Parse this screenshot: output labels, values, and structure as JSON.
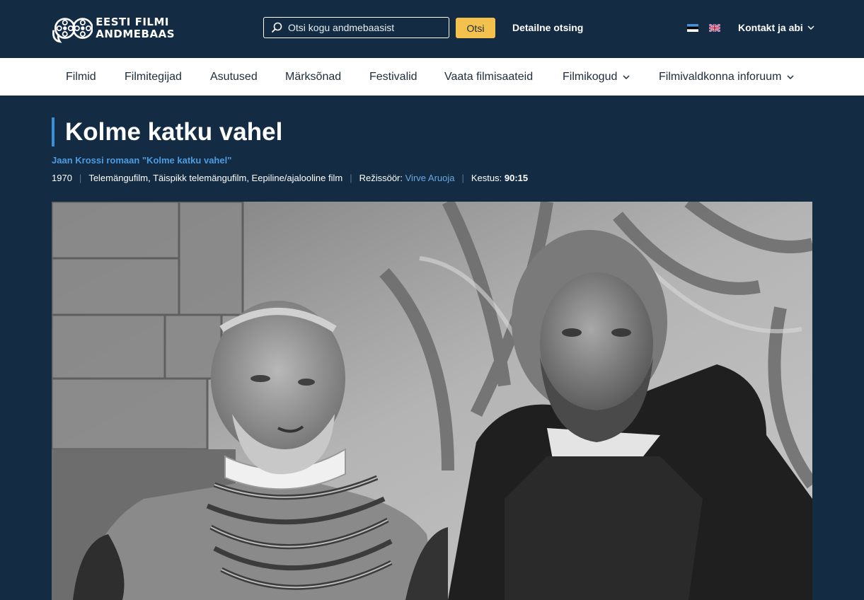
{
  "header": {
    "logo_line1": "EESTI FILMI",
    "logo_line2": "ANDMEBAAS",
    "search_placeholder": "Otsi kogu andmebaasist",
    "search_button": "Otsi",
    "advanced_search": "Detailne otsing",
    "contact": "Kontakt ja abi",
    "languages": [
      "estonian-flag-icon",
      "uk-flag-icon"
    ]
  },
  "nav": {
    "items": [
      {
        "label": "Filmid",
        "has_dropdown": false
      },
      {
        "label": "Filmitegijad",
        "has_dropdown": false
      },
      {
        "label": "Asutused",
        "has_dropdown": false
      },
      {
        "label": "Märksõnad",
        "has_dropdown": false
      },
      {
        "label": "Festivalid",
        "has_dropdown": false
      },
      {
        "label": "Vaata filmisaateid",
        "has_dropdown": false
      },
      {
        "label": "Filmikogud",
        "has_dropdown": true
      },
      {
        "label": "Filmivaldkonna inforuum",
        "has_dropdown": true
      }
    ]
  },
  "film": {
    "title": "Kolme katku vahel",
    "subtitle": "Jaan Krossi romaan \"Kolme katku vahel\"",
    "year": "1970",
    "genres": "Telemängufilm, Täispikk telemängufilm, Eepiline/ajalooline film",
    "director_label": "Režissöör:",
    "director": "Virve Aruoja",
    "duration_label": "Kestus:",
    "duration": "90:15"
  },
  "colors": {
    "background": "#132c44",
    "accent_button": "#f2c14e",
    "link": "#6aa8e0",
    "title_bar": "#3a8fd6"
  }
}
